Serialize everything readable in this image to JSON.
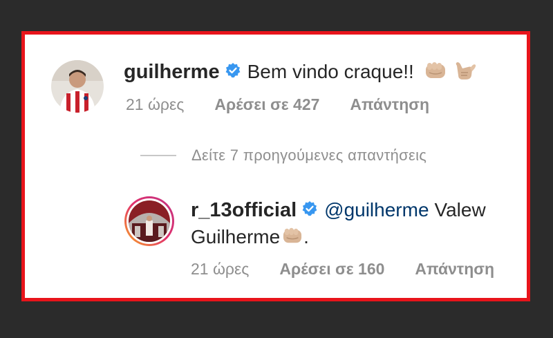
{
  "colors": {
    "frame_border": "#e8141b",
    "background": "#2b2b2b",
    "verified_badge": "#3897f0",
    "mention": "#00376b",
    "meta_text": "#8e8e8e"
  },
  "comment1": {
    "username": "guilherme",
    "verified": true,
    "text": "Bem vindo craque!!",
    "emojis": [
      "fist-emoji",
      "call-me-hand-emoji"
    ],
    "time": "21 ώρες",
    "likes": "Αρέσει σε 427",
    "reply": "Απάντηση"
  },
  "view_replies": {
    "label": "Δείτε 7 προηγούμενες απαντήσεις"
  },
  "comment2": {
    "username": "r_13official",
    "verified": true,
    "mention": "@guilherme",
    "text_after_mention": "Valew",
    "text_line2": "Guilherme",
    "text_end": ".",
    "emojis": [
      "fist-emoji"
    ],
    "time": "21 ώρες",
    "likes": "Αρέσει σε 160",
    "reply": "Απάντηση"
  }
}
